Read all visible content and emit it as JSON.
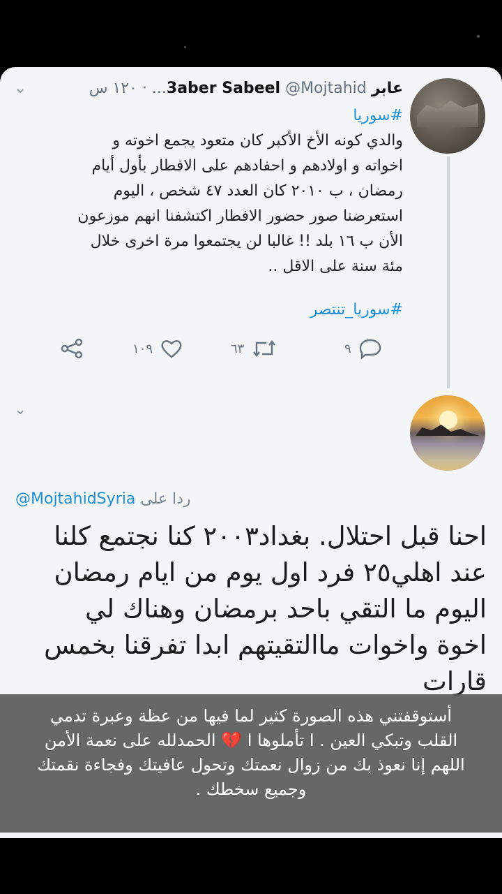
{
  "tweet": {
    "display_name": "عابر",
    "name_latin": "3aber Sabeel",
    "handle": "@Mojtahid...",
    "time": "١٢٠ س",
    "hashtag_top": "#سوريا",
    "lines": [
      "والدي كونه الأخ الأكبر كان متعود يجمع اخوته و",
      "اخواته و اولادهم و احفادهم على الافطار بأول أيام",
      "رمضان ، ب ٢٠١٠ كان العدد ٤٧ شخص ، اليوم",
      "استعرضنا صور حضور الافطار اكتشفنا انهم موزعون",
      "الأن ب ١٦ بلد !! غالبا لن يجتمعوا مرة اخرى خلال",
      "مئة سنة على الاقل .."
    ],
    "hashtag_bottom": "#سوريا_تنتصر",
    "stats": {
      "replies": "٩",
      "retweets": "٦٣",
      "likes": "١٠٩"
    }
  },
  "reply": {
    "replying_to_label": "ردا على",
    "replying_to_handle": "@MojtahidSyria",
    "lines": [
      "احنا قبل احتلال. بغداد٢٠٠٣ كنا نجتمع كلنا",
      "عند اهلي٢٥ فرد اول يوم من ايام رمضان",
      "اليوم ما التقي باحد برمضان وهناك لي",
      "اخوة واخوات ماالتقيتهم ابدا تفرقنا بخمس",
      "قارات"
    ]
  },
  "caption": {
    "line1": "أستوقفتني هذه الصورة كثير لما فيها من عظة وعبرة تدمي",
    "line2_a": "القلب وتبكي العين . ا تأملوها ا",
    "line2_b": "الحمدلله على نعمة الأمن",
    "line3": "اللهم إنا نعوذ بك من زوال نعمتك وتحول عافيتك وفجاءة نقمتك",
    "line4": "وجميع سخطك ."
  },
  "colors": {
    "link": "#1d8fd8",
    "card": "#f3f5f7",
    "overlay": "#5a5a5a",
    "broken_heart": "#c0262d"
  }
}
